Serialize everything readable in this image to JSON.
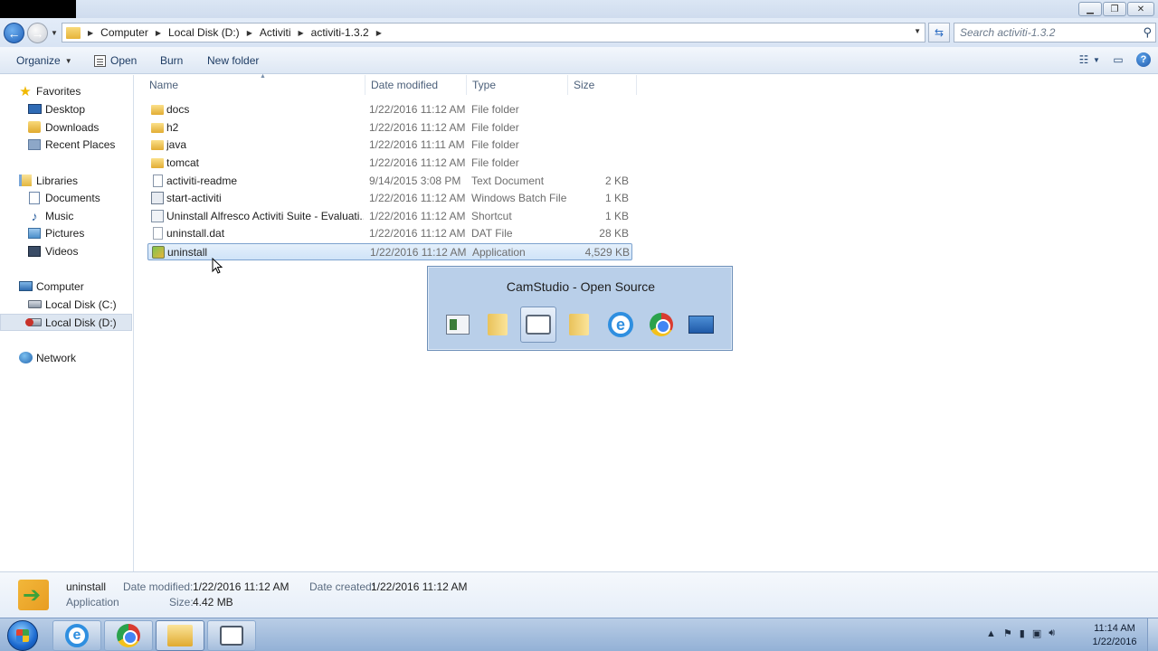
{
  "window": {
    "minimize_icon": "minimize-icon",
    "maximize_icon": "maximize-icon",
    "close_icon": "close-icon"
  },
  "address": {
    "crumbs": [
      "Computer",
      "Local Disk (D:)",
      "Activiti",
      "activiti-1.3.2"
    ],
    "search_placeholder": "Search activiti-1.3.2"
  },
  "toolbar": {
    "organize": "Organize",
    "open": "Open",
    "burn": "Burn",
    "new_folder": "New folder"
  },
  "nav": {
    "favorites": "Favorites",
    "desktop": "Desktop",
    "downloads": "Downloads",
    "recent_places": "Recent Places",
    "libraries": "Libraries",
    "documents": "Documents",
    "music": "Music",
    "pictures": "Pictures",
    "videos": "Videos",
    "computer": "Computer",
    "local_c": "Local Disk (C:)",
    "local_d": "Local Disk (D:)",
    "network": "Network"
  },
  "columns": {
    "name": "Name",
    "date": "Date modified",
    "type": "Type",
    "size": "Size"
  },
  "files": [
    {
      "name": "docs",
      "date": "1/22/2016 11:12 AM",
      "type": "File folder",
      "size": "",
      "icon": "folder-icon"
    },
    {
      "name": "h2",
      "date": "1/22/2016 11:12 AM",
      "type": "File folder",
      "size": "",
      "icon": "folder-icon"
    },
    {
      "name": "java",
      "date": "1/22/2016 11:11 AM",
      "type": "File folder",
      "size": "",
      "icon": "folder-icon"
    },
    {
      "name": "tomcat",
      "date": "1/22/2016 11:12 AM",
      "type": "File folder",
      "size": "",
      "icon": "folder-icon"
    },
    {
      "name": "activiti-readme",
      "date": "9/14/2015 3:08 PM",
      "type": "Text Document",
      "size": "2 KB",
      "icon": "text-file-icon"
    },
    {
      "name": "start-activiti",
      "date": "1/22/2016 11:12 AM",
      "type": "Windows Batch File",
      "size": "1 KB",
      "icon": "batch-file-icon"
    },
    {
      "name": "Uninstall Alfresco Activiti Suite - Evaluati...",
      "date": "1/22/2016 11:12 AM",
      "type": "Shortcut",
      "size": "1 KB",
      "icon": "shortcut-icon"
    },
    {
      "name": "uninstall.dat",
      "date": "1/22/2016 11:12 AM",
      "type": "DAT File",
      "size": "28 KB",
      "icon": "dat-file-icon"
    },
    {
      "name": "uninstall",
      "date": "1/22/2016 11:12 AM",
      "type": "Application",
      "size": "4,529 KB",
      "icon": "application-icon",
      "selected": true
    }
  ],
  "alttab": {
    "title": "CamStudio - Open Source"
  },
  "details": {
    "name": "uninstall",
    "kind": "Application",
    "date_modified_label": "Date modified:",
    "date_modified": "1/22/2016 11:12 AM",
    "size_label": "Size:",
    "size": "4.42 MB",
    "date_created_label": "Date created:",
    "date_created": "1/22/2016 11:12 AM"
  },
  "taskbar": {
    "time": "11:14 AM",
    "date": "1/22/2016"
  }
}
